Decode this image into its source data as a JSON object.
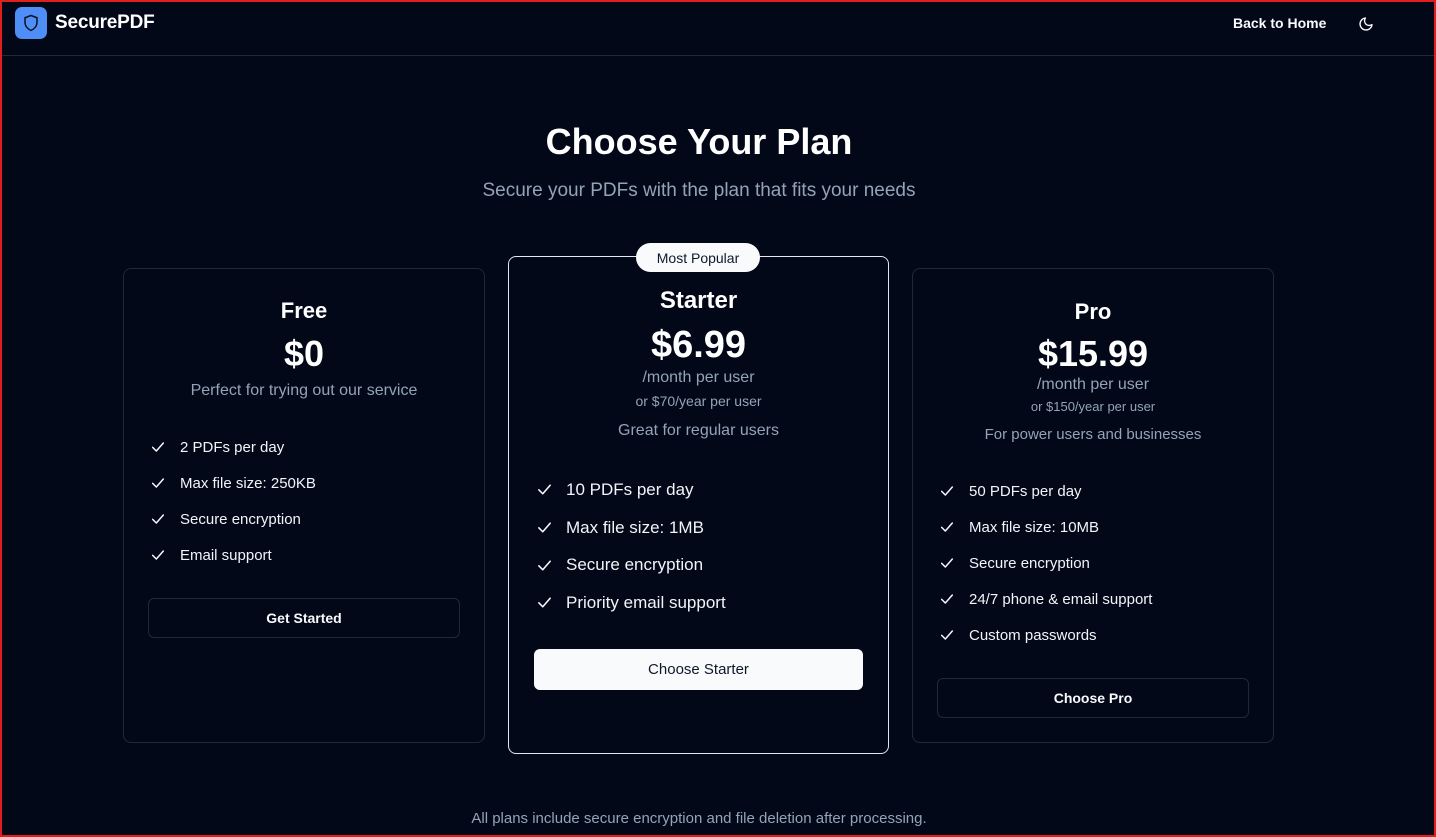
{
  "header": {
    "brand": "SecurePDF",
    "back_link": "Back to Home",
    "logo_icon": "shield-icon",
    "theme_icon": "moon-icon"
  },
  "hero": {
    "title": "Choose Your Plan",
    "subtitle": "Secure your PDFs with the plan that fits your needs"
  },
  "plans": [
    {
      "name": "Free",
      "price": "$0",
      "description": "Perfect for trying out our service",
      "features": [
        "2 PDFs per day",
        "Max file size: 250KB",
        "Secure encryption",
        "Email support"
      ],
      "button": "Get Started"
    },
    {
      "name": "Starter",
      "badge": "Most Popular",
      "price": "$6.99",
      "period": "/month per user",
      "yearly": "or $70/year per user",
      "description": "Great for regular users",
      "features": [
        "10 PDFs per day",
        "Max file size: 1MB",
        "Secure encryption",
        "Priority email support"
      ],
      "button": "Choose Starter"
    },
    {
      "name": "Pro",
      "price": "$15.99",
      "period": "/month per user",
      "yearly": "or $150/year per user",
      "description": "For power users and businesses",
      "features": [
        "50 PDFs per day",
        "Max file size: 10MB",
        "Secure encryption",
        "24/7 phone & email support",
        "Custom passwords"
      ],
      "button": "Choose Pro"
    }
  ],
  "footnote": "All plans include secure encryption and file deletion after processing.",
  "colors": {
    "background": "#020817",
    "accent": "#4f8ef7",
    "muted_text": "#94a3b8",
    "border": "#1e293b"
  }
}
